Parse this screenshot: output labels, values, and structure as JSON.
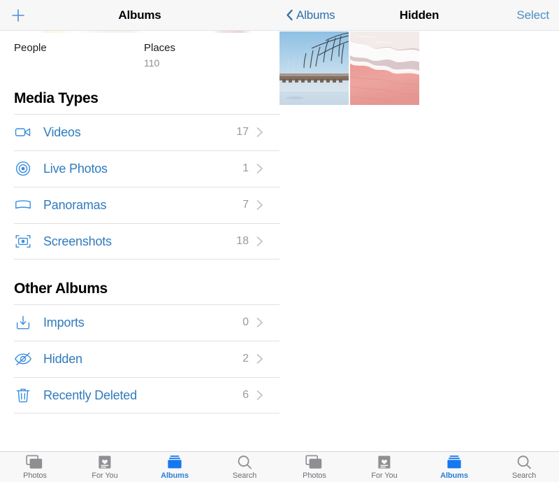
{
  "left_screen": {
    "navbar": {
      "add_icon": "plus-icon",
      "title": "Albums"
    },
    "smart_albums": [
      {
        "title": "People",
        "count": ""
      },
      {
        "title": "Places",
        "count": "110"
      }
    ],
    "sections": [
      {
        "header": "Media Types",
        "rows": [
          {
            "icon": "video-camera-icon",
            "label": "Videos",
            "count": "17"
          },
          {
            "icon": "live-photo-icon",
            "label": "Live Photos",
            "count": "1"
          },
          {
            "icon": "panorama-icon",
            "label": "Panoramas",
            "count": "7"
          },
          {
            "icon": "screenshot-icon",
            "label": "Screenshots",
            "count": "18"
          }
        ]
      },
      {
        "header": "Other Albums",
        "rows": [
          {
            "icon": "import-icon",
            "label": "Imports",
            "count": "0"
          },
          {
            "icon": "hidden-eye-icon",
            "label": "Hidden",
            "count": "2"
          },
          {
            "icon": "trash-icon",
            "label": "Recently Deleted",
            "count": "6"
          }
        ]
      }
    ],
    "tabbar": {
      "tabs": [
        {
          "label": "Photos",
          "icon": "photos-icon",
          "active": false
        },
        {
          "label": "For You",
          "icon": "for-you-icon",
          "active": false
        },
        {
          "label": "Albums",
          "icon": "albums-icon",
          "active": true
        },
        {
          "label": "Search",
          "icon": "search-icon",
          "active": false
        }
      ]
    }
  },
  "right_screen": {
    "navbar": {
      "back_label": "Albums",
      "title": "Hidden",
      "action_label": "Select"
    },
    "photos": [
      {
        "name": "winter-lake-willow-bridge-photo"
      },
      {
        "name": "pink-sand-beach-surf-photo"
      }
    ],
    "tabbar": {
      "tabs": [
        {
          "label": "Photos",
          "icon": "photos-icon",
          "active": false
        },
        {
          "label": "For You",
          "icon": "for-you-icon",
          "active": false
        },
        {
          "label": "Albums",
          "icon": "albums-icon",
          "active": true
        },
        {
          "label": "Search",
          "icon": "search-icon",
          "active": false
        }
      ]
    }
  },
  "colors": {
    "accent_blue": "#2f7bbd",
    "icon_blue": "#3a8dde",
    "tab_active": "#1478ef",
    "secondary_text": "#8e8e93",
    "navbar_bg": "#f7f7f7",
    "tabbar_bg": "#f8f8f8"
  }
}
